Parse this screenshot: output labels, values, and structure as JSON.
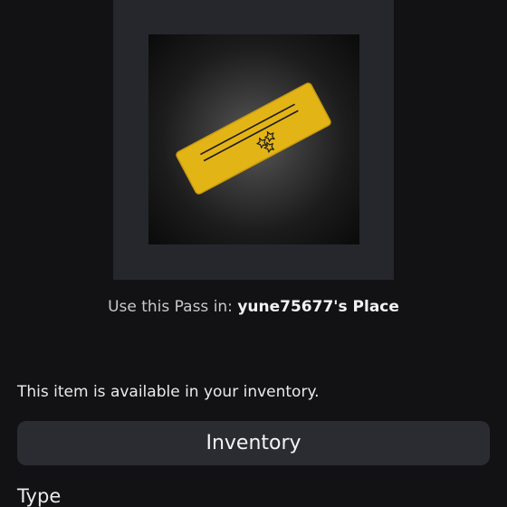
{
  "item": {
    "thumbnail_icon": "gold-pass-ticket-icon"
  },
  "place_info": {
    "prefix": "Use this Pass in: ",
    "place_name": "yune75677's Place"
  },
  "ownership": {
    "available_text": "This item is available in your inventory."
  },
  "actions": {
    "inventory_label": "Inventory"
  },
  "details": {
    "type_heading": "Type"
  },
  "colors": {
    "background": "#121215",
    "card_background": "#25272c",
    "button_background": "#2a2c31",
    "pass_gold": "#e5b81a"
  }
}
